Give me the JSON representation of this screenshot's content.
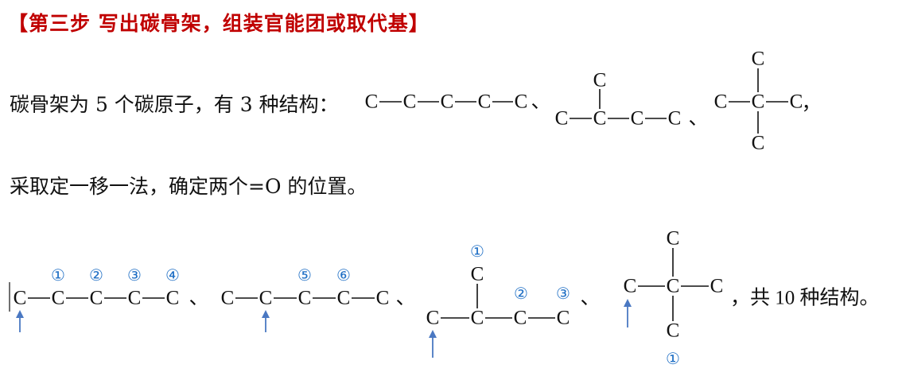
{
  "title": "【第三步  写出碳骨架，组装官能团或取代基】",
  "line1": "碳骨架为 5 个碳原子，有 3 种结构：",
  "line2": "采取定一移一法，确定两个=O 的位置。",
  "atom": "C",
  "sep": "、",
  "comma": "，",
  "conclusion": "，共 10 种结构。",
  "positions": [
    "①",
    "②",
    "③",
    "④",
    "⑤",
    "⑥"
  ],
  "colors": {
    "title": "#c00000",
    "marker": "#1f6fc5",
    "arrow": "#4a78c2"
  }
}
